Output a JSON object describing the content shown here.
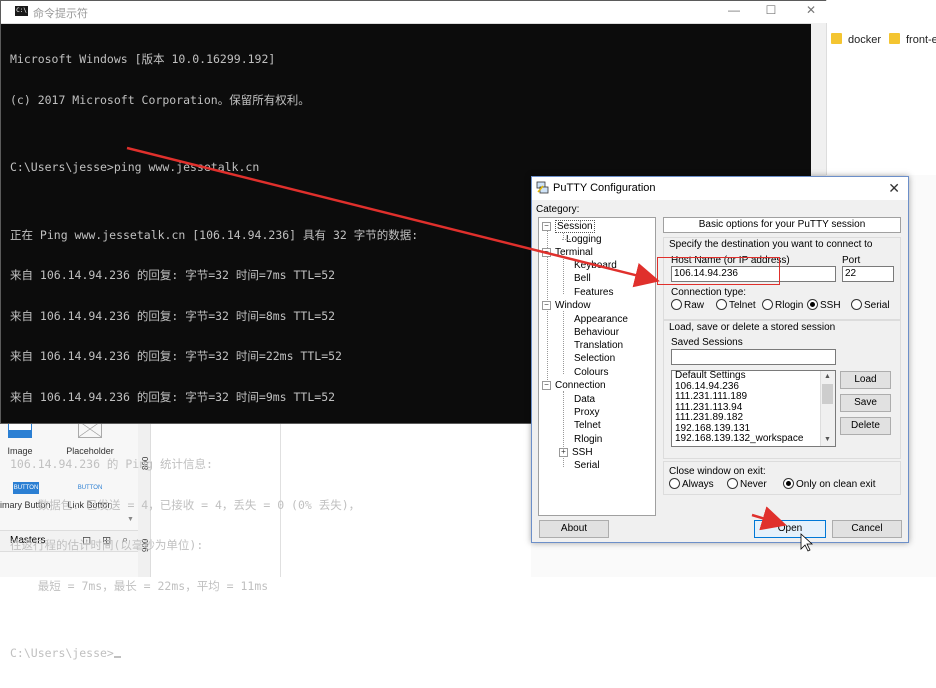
{
  "cmd": {
    "title": "命令提示符",
    "lines": [
      "Microsoft Windows [版本 10.0.16299.192]",
      "(c) 2017 Microsoft Corporation。保留所有权利。",
      "",
      "C:\\Users\\jesse>ping www.jessetalk.cn",
      "",
      "正在 Ping www.jessetalk.cn [106.14.94.236] 具有 32 字节的数据:",
      "来自 106.14.94.236 的回复: 字节=32 时间=7ms TTL=52",
      "来自 106.14.94.236 的回复: 字节=32 时间=8ms TTL=52",
      "来自 106.14.94.236 的回复: 字节=32 时间=22ms TTL=52",
      "来自 106.14.94.236 的回复: 字节=32 时间=9ms TTL=52",
      "",
      "106.14.94.236 的 Ping 统计信息:",
      "    数据包: 已发送 = 4，已接收 = 4，丢失 = 0 (0% 丢失)，",
      "往返行程的估计时间(以毫秒为单位):",
      "    最短 = 7ms，最长 = 22ms，平均 = 11ms",
      "",
      "C:\\Users\\jesse>"
    ],
    "minimize": "—",
    "maximize": "☐",
    "close": "✕"
  },
  "explorer": {
    "folders": [
      "docker",
      "front-e"
    ]
  },
  "bgapp": {
    "widgets": [
      {
        "label": "Image"
      },
      {
        "label": "Placeholder"
      },
      {
        "label": "imary Button",
        "icon_text": "BUTTON"
      },
      {
        "label": "Link Button",
        "icon_text": "BUTTON"
      }
    ],
    "masters_label": "Masters",
    "ruler": [
      "800",
      "900"
    ]
  },
  "putty": {
    "title": "PuTTY Configuration",
    "close": "✕",
    "category_label": "Category:",
    "tree": [
      {
        "label": "Session",
        "level": 0,
        "toggle": "−",
        "selected": true
      },
      {
        "label": "Logging",
        "level": 1
      },
      {
        "label": "Terminal",
        "level": 0,
        "toggle": "−"
      },
      {
        "label": "Keyboard",
        "level": 1
      },
      {
        "label": "Bell",
        "level": 1
      },
      {
        "label": "Features",
        "level": 1
      },
      {
        "label": "Window",
        "level": 0,
        "toggle": "−"
      },
      {
        "label": "Appearance",
        "level": 1
      },
      {
        "label": "Behaviour",
        "level": 1
      },
      {
        "label": "Translation",
        "level": 1
      },
      {
        "label": "Selection",
        "level": 1
      },
      {
        "label": "Colours",
        "level": 1
      },
      {
        "label": "Connection",
        "level": 0,
        "toggle": "−"
      },
      {
        "label": "Data",
        "level": 1
      },
      {
        "label": "Proxy",
        "level": 1
      },
      {
        "label": "Telnet",
        "level": 1
      },
      {
        "label": "Rlogin",
        "level": 1
      },
      {
        "label": "SSH",
        "level": 1,
        "toggle": "+"
      },
      {
        "label": "Serial",
        "level": 1
      }
    ],
    "header": "Basic options for your PuTTY session",
    "dest_label": "Specify the destination you want to connect to",
    "host_label": "Host Name (or IP address)",
    "host_value": "106.14.94.236",
    "port_label": "Port",
    "port_value": "22",
    "conn_type_label": "Connection type:",
    "conn_types": [
      {
        "label": "Raw",
        "selected": false
      },
      {
        "label": "Telnet",
        "selected": false
      },
      {
        "label": "Rlogin",
        "selected": false
      },
      {
        "label": "SSH",
        "selected": true
      },
      {
        "label": "Serial",
        "selected": false
      }
    ],
    "sessions_group_label": "Load, save or delete a stored session",
    "saved_sessions_label": "Saved Sessions",
    "saved_sessions_value": "",
    "sessions": [
      "Default Settings",
      "106.14.94.236",
      "111.231.111.189",
      "111.231.113.94",
      "111.231.89.182",
      "192.168.139.131",
      "192.168.139.132_workspace"
    ],
    "load_label": "Load",
    "save_label": "Save",
    "delete_label": "Delete",
    "close_exit_label": "Close window on exit:",
    "exit_options": [
      {
        "label": "Always",
        "selected": false
      },
      {
        "label": "Never",
        "selected": false
      },
      {
        "label": "Only on clean exit",
        "selected": true
      }
    ],
    "about_label": "About",
    "open_label": "Open",
    "cancel_label": "Cancel"
  },
  "colors": {
    "annotation_red": "#e0302c",
    "cmd_bg": "#0c0c0c",
    "cmd_fg": "#c0c0c0"
  }
}
